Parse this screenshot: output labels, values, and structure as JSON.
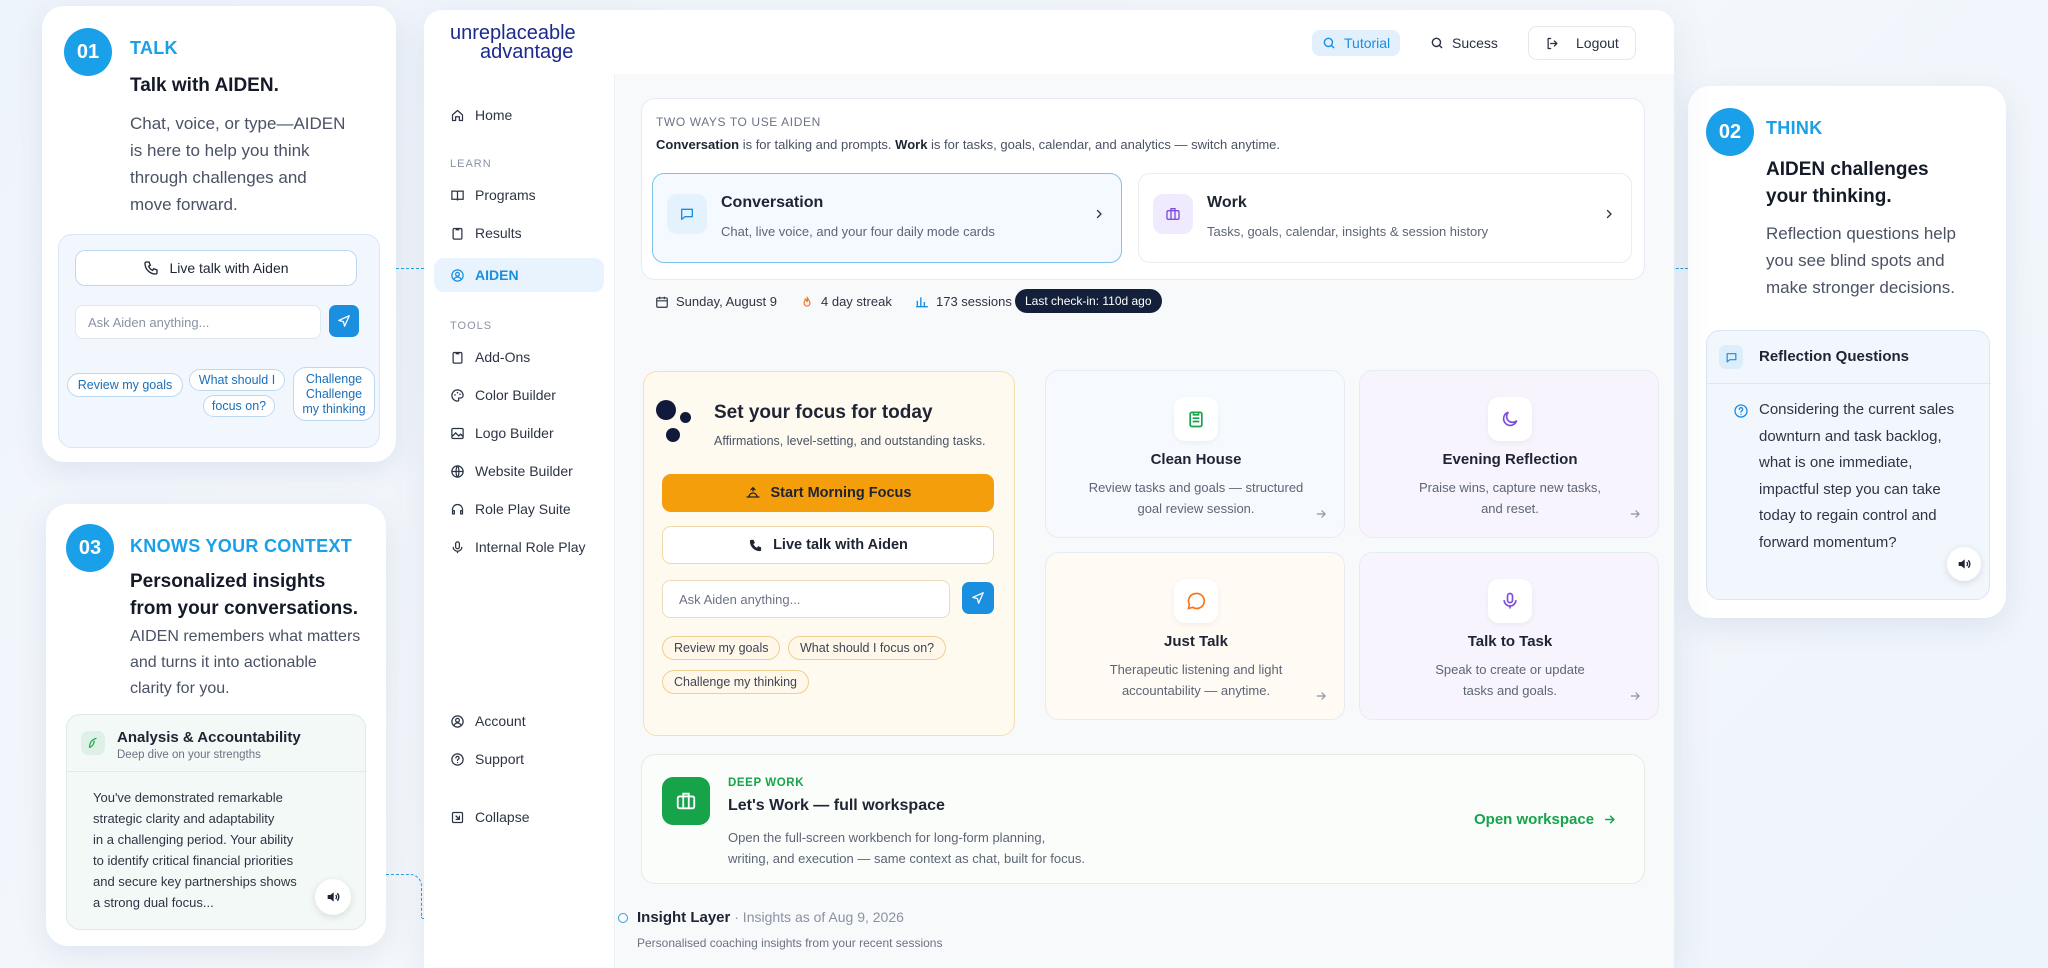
{
  "callouts": {
    "talk": {
      "number": "01",
      "kicker": "TALK",
      "title": "Talk with AIDEN.",
      "description_lines": [
        "Chat, voice, or type—AIDEN",
        "is here to help you think",
        "through challenges and",
        "move forward."
      ],
      "live_button": "Live talk with Aiden",
      "input_placeholder": "Ask Aiden anything...",
      "chips": [
        "Review my goals",
        "What should I",
        "focus on?",
        "Challenge",
        "Challenge",
        "my thinking"
      ]
    },
    "think": {
      "number": "02",
      "kicker": "THINK",
      "title_lines": [
        "AIDEN challenges",
        "your thinking."
      ],
      "description_lines": [
        "Reflection questions help",
        "you see blind spots and",
        "make stronger decisions."
      ],
      "panel_title": "Reflection Questions",
      "question_lines": [
        "Considering the current sales",
        "downturn and task backlog,",
        "what is one immediate,",
        "impactful step you can take",
        "today to regain control and",
        "forward momentum?"
      ]
    },
    "context": {
      "number": "03",
      "kicker": "KNOWS YOUR CONTEXT",
      "title_lines": [
        "Personalized insights",
        "from your conversations."
      ],
      "description_lines": [
        "AIDEN remembers what matters",
        "and turns it into actionable",
        "clarity for you."
      ],
      "panel_title": "Analysis & Accountability",
      "panel_subtitle": "Deep dive on your strengths",
      "analysis_lines": [
        "You've demonstrated remarkable",
        "strategic clarity and adaptability",
        "in a challenging period. Your ability",
        "to identify critical financial priorities",
        "and secure key partnerships shows",
        "a strong dual focus..."
      ]
    }
  },
  "app": {
    "logo_line1": "unreplaceable",
    "logo_line2": "advantage",
    "top": {
      "tutorial": "Tutorial",
      "success": "Sucess",
      "logout": "Logout"
    },
    "nav": {
      "home": "Home",
      "learn_section": "LEARN",
      "programs": "Programs",
      "results": "Results",
      "aiden": "AIDEN",
      "tools_section": "TOOLS",
      "addons": "Add-Ons",
      "color_builder": "Color Builder",
      "logo_builder": "Logo Builder",
      "website_builder": "Website Builder",
      "role_play": "Role Play Suite",
      "internal_role_play": "Internal Role Play",
      "account": "Account",
      "support": "Support",
      "collapse": "Collapse"
    },
    "two_ways": {
      "heading": "TWO WAYS TO USE AIDEN",
      "sub_bold1": "Conversation",
      "sub_text1": " is for talking and prompts. ",
      "sub_bold2": "Work",
      "sub_text2": " is for tasks, goals, calendar, and analytics — switch anytime.",
      "conversation_title": "Conversation",
      "conversation_desc": "Chat, live voice, and your four daily mode cards",
      "work_title": "Work",
      "work_desc": "Tasks, goals, calendar, insights & session history"
    },
    "stats": {
      "date": "Sunday, August 9",
      "streak": "4 day streak",
      "sessions": "173 sessions",
      "checkin": "Last check-in: 110d ago"
    },
    "focus": {
      "title": "Set your focus for today",
      "subtitle": "Affirmations, level-setting, and outstanding tasks.",
      "start_button": "Start Morning Focus",
      "live_button": "Live talk with Aiden",
      "input_placeholder": "Ask Aiden anything...",
      "chips": [
        "Review my goals",
        "What should I focus on?",
        "Challenge my thinking"
      ]
    },
    "tiles": [
      {
        "title": "Clean House",
        "desc_lines": [
          "Review tasks and goals — structured",
          "goal review session."
        ],
        "icon": "clipboard-icon"
      },
      {
        "title": "Evening Reflection",
        "desc_lines": [
          "Praise wins, capture new tasks,",
          "and reset."
        ],
        "icon": "moon-icon"
      },
      {
        "title": "Just Talk",
        "desc_lines": [
          "Therapeutic listening and light",
          "accountability — anytime."
        ],
        "icon": "chat-icon"
      },
      {
        "title": "Talk to Task",
        "desc_lines": [
          "Speak to create or update",
          "tasks and goals."
        ],
        "icon": "microphone-icon"
      }
    ],
    "deep_work": {
      "kicker": "DEEP WORK",
      "title": "Let's Work — full workspace",
      "desc_lines": [
        "Open the full-screen workbench for long-form planning,",
        "writing, and execution — same context as chat, built for focus."
      ],
      "open_link": "Open workspace"
    },
    "insight": {
      "title": "Insight Layer",
      "as_of": " · Insights as of Aug 9, 2026",
      "subtitle": "Personalised coaching insights from your recent sessions"
    }
  },
  "colors": {
    "accent": "#1aa0e8",
    "orange": "#f59e0b",
    "green": "#16a34a",
    "navy": "#14203a"
  }
}
